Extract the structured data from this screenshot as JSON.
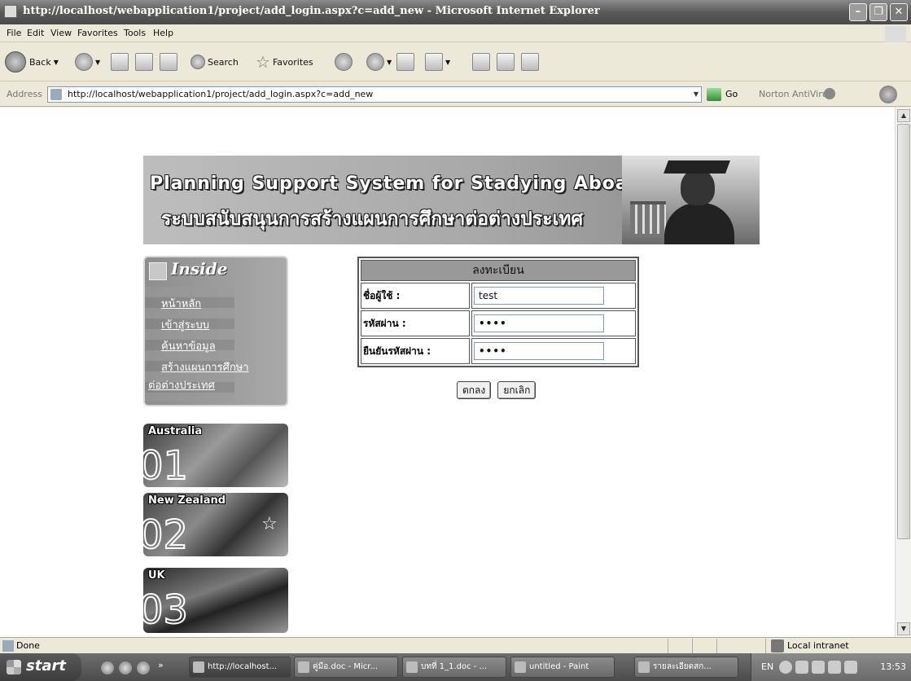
{
  "window": {
    "title": "http://localhost/webapplication1/project/add_login.aspx?c=add_new - Microsoft Internet Explorer"
  },
  "menu": [
    "File",
    "Edit",
    "View",
    "Favorites",
    "Tools",
    "Help"
  ],
  "toolbar": {
    "back_label": "Back",
    "search_label": "Search",
    "favorites_label": "Favorites"
  },
  "address": {
    "label": "Address",
    "url": "http://localhost/webapplication1/project/add_login.aspx?c=add_new",
    "go_label": "Go",
    "norton_label": "Norton AntiVirus"
  },
  "banner": {
    "title_en": "Planning Support System for Stadying Aboard",
    "title_th": "ระบบสนับสนุนการสร้างแผนการศึกษาต่อต่างประเทศ"
  },
  "sidebar": {
    "heading": "Inside",
    "links": [
      "หน้าหลัก",
      "เข้าสู่ระบบ",
      "ค้นหาข้อมูล",
      "สร้างแผนการศึกษา",
      "ต่อต่างประเทศ"
    ]
  },
  "tiles": [
    {
      "name": "Australia",
      "num": "01"
    },
    {
      "name": "New Zealand",
      "num": "02"
    },
    {
      "name": "UK",
      "num": "03"
    }
  ],
  "form": {
    "heading": "ลงทะเบียน",
    "username_label": "ชื่อผู้ใช้ :",
    "username_value": "test",
    "password_label": "รหัสผ่าน :",
    "password_value": "••••",
    "confirm_label": "ยืนยันรหัสผ่าน :",
    "confirm_value": "••••",
    "ok_label": "ตกลง",
    "cancel_label": "ยกเลิก"
  },
  "status": {
    "text": "Done",
    "zone": "Local intranet"
  },
  "taskbar": {
    "start_label": "start",
    "tasks": [
      "http://localhost...",
      "คู่มือ.doc - Micr...",
      "บทที่ 1_1.doc - ...",
      "untitled - Paint",
      "รายละเอียดสก..."
    ],
    "lang": "EN",
    "clock": "13:53"
  }
}
